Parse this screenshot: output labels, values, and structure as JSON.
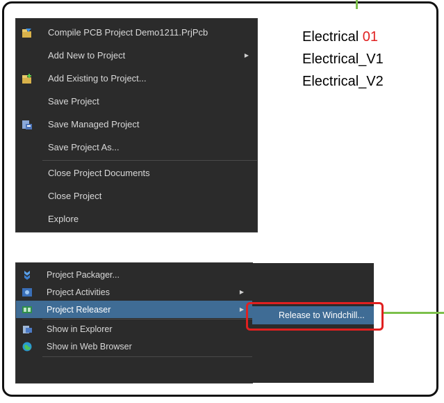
{
  "names": {
    "line1_prefix": "Electrical ",
    "line1_number": "01",
    "line2": "Electrical_V1",
    "line3": "Electrical_V2"
  },
  "context_menu": {
    "items": [
      {
        "label": "Compile PCB Project Demo1211.PrjPcb",
        "icon": "compile-icon"
      },
      {
        "label": "Add New to Project",
        "submenu": true
      },
      {
        "label": "Add Existing to Project...",
        "icon": "add-existing-icon"
      },
      {
        "label": "Save Project"
      },
      {
        "label": "Save Managed Project",
        "icon": "save-managed-icon"
      },
      {
        "label": "Save Project As..."
      },
      {
        "label": "Close Project Documents"
      },
      {
        "label": "Close Project"
      },
      {
        "label": "Explore"
      }
    ]
  },
  "project_menu": {
    "items": [
      {
        "label": "Project Packager...",
        "icon": "packager-icon"
      },
      {
        "label": "Project Activities",
        "icon": "activities-icon",
        "submenu": true
      },
      {
        "label": "Project Releaser",
        "icon": "releaser-icon",
        "submenu": true,
        "active": true
      },
      {
        "label": "Show in Explorer",
        "icon": "explorer-icon"
      },
      {
        "label": "Show in Web Browser",
        "icon": "web-browser-icon"
      }
    ]
  },
  "submenu": {
    "item": "Release to Windchill..."
  },
  "colors": {
    "accent_line": "#7cc04b",
    "highlight": "#e02020",
    "menu_bg": "#2b2b2b",
    "active_bg": "#3f6c95"
  }
}
